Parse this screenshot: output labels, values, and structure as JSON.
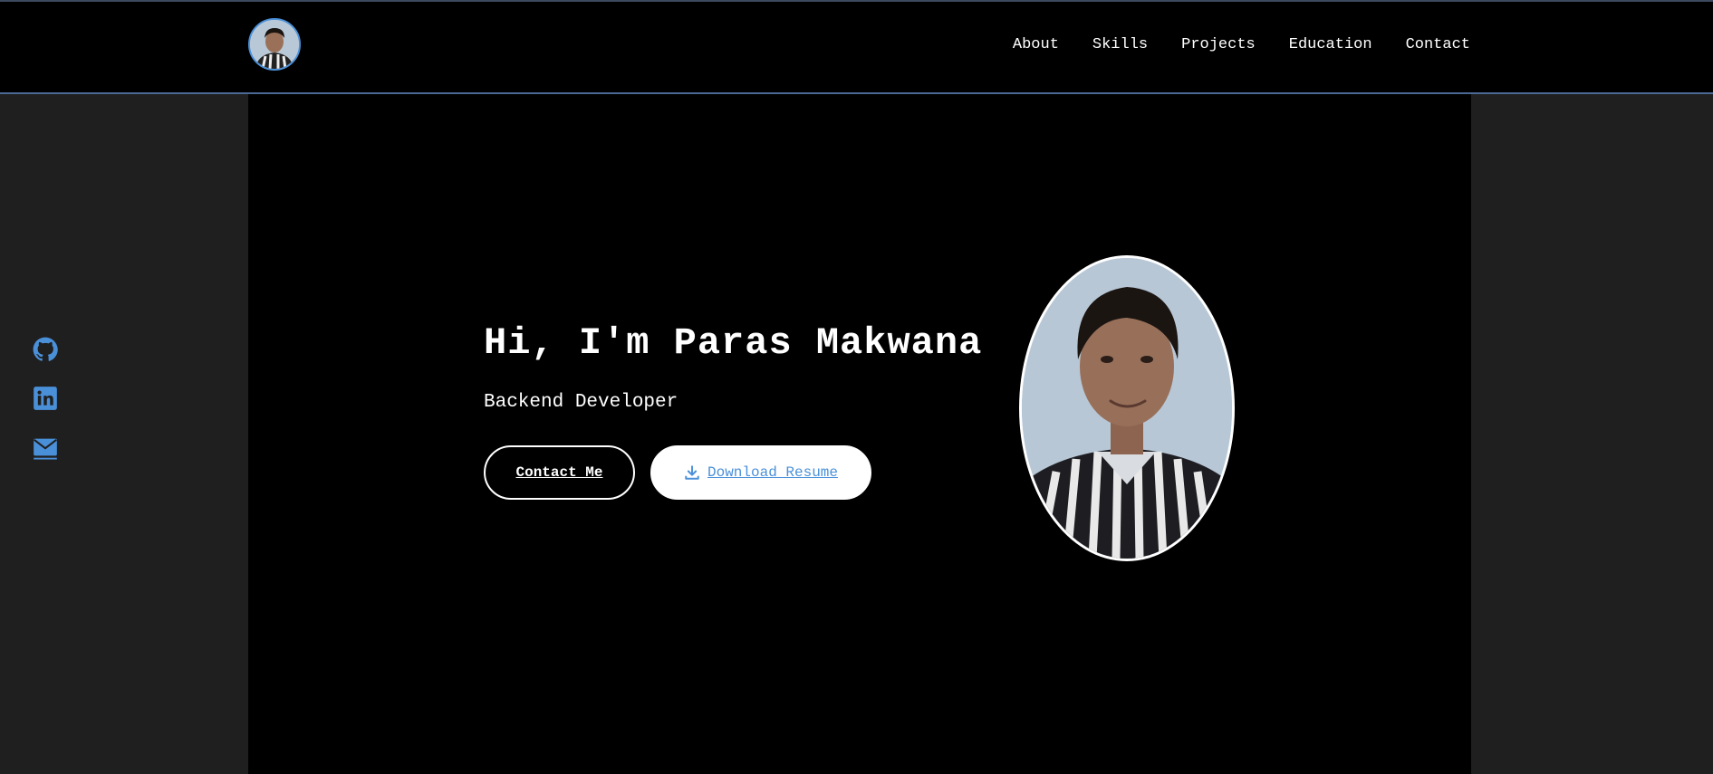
{
  "nav": {
    "avatar_alt": "Profile",
    "links": [
      {
        "label": "About"
      },
      {
        "label": "Skills"
      },
      {
        "label": "Projects"
      },
      {
        "label": "Education"
      },
      {
        "label": "Contact"
      }
    ]
  },
  "hero": {
    "title": "Hi, I'm Paras Makwana",
    "subtitle": "Backend Developer",
    "contact_label": "Contact Me",
    "resume_label": "Download Resume",
    "resume_icon": "download-icon"
  },
  "social": {
    "items": [
      {
        "icon": "github-icon"
      },
      {
        "icon": "linkedin-icon"
      },
      {
        "icon": "envelope-icon"
      }
    ]
  },
  "colors": {
    "accent": "#4a90d9",
    "background": "#000000",
    "side_background": "#1f1f1f",
    "text": "#ffffff"
  }
}
